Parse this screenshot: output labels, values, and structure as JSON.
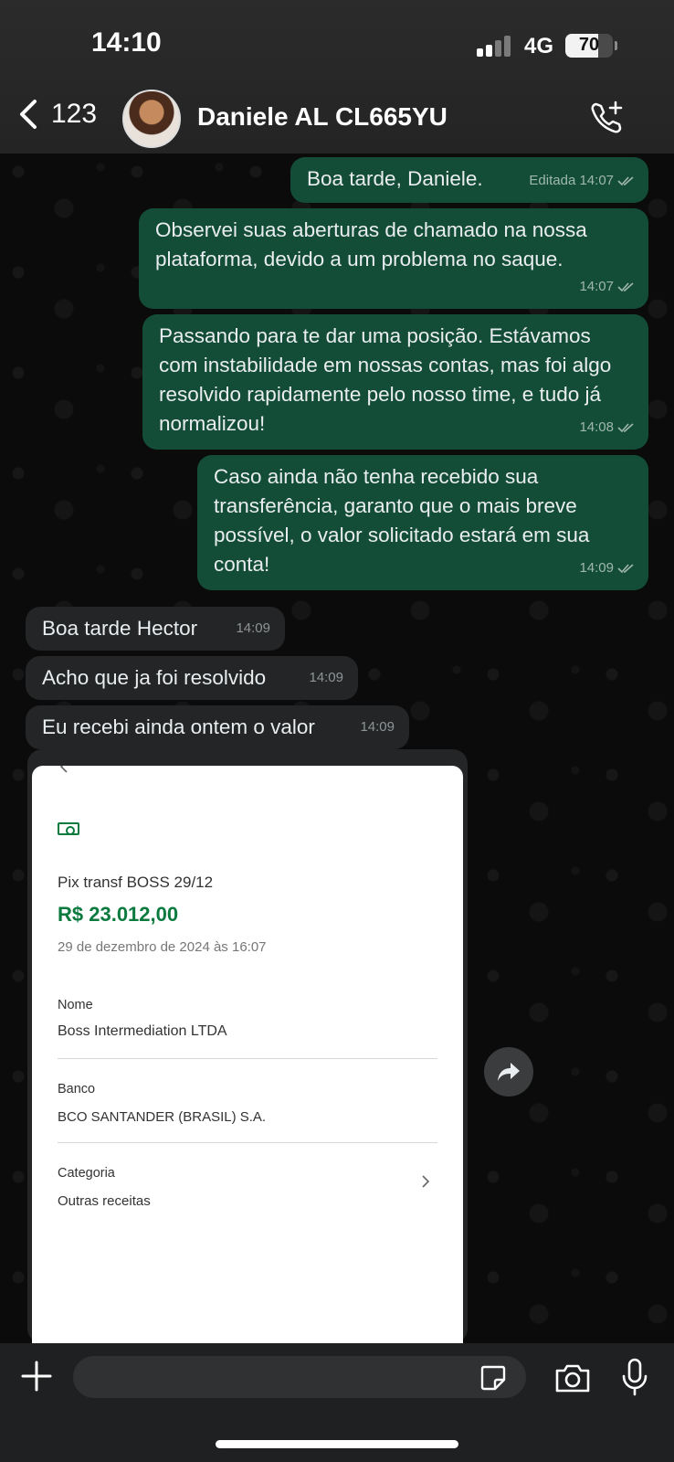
{
  "status_bar": {
    "time": "14:10",
    "network": "4G",
    "battery": "70"
  },
  "header": {
    "back_count": "123",
    "contact_name": "Daniele AL CL665YU"
  },
  "messages": [
    {
      "text": "Boa tarde, Daniele.",
      "meta": "Editada 14:07",
      "direction": "out"
    },
    {
      "text": "Observei suas aberturas de chamado na nossa plataforma, devido a um problema no saque.",
      "meta": "14:07",
      "direction": "out"
    },
    {
      "text": "Passando para te dar uma posição. Estávamos com instabilidade em nossas contas, mas foi algo resolvido rapidamente pelo nosso time, e tudo já normalizou!",
      "meta": "14:08",
      "direction": "out"
    },
    {
      "text": "Caso ainda não tenha recebido sua transferência, garanto que o mais breve possível, o valor solicitado estará em sua conta!",
      "meta": "14:09",
      "direction": "out"
    },
    {
      "text": "Boa tarde Hector",
      "meta": "14:09",
      "direction": "in"
    },
    {
      "text": "Acho que ja foi resolvido",
      "meta": "14:09",
      "direction": "in"
    },
    {
      "text": "Eu recebi ainda ontem o valor",
      "meta": "14:09",
      "direction": "in"
    }
  ],
  "receipt": {
    "title": "Pix transf BOSS 29/12",
    "amount": "R$ 23.012,00",
    "date": "29 de dezembro de 2024 às 16:07",
    "name_label": "Nome",
    "name_value": "Boss Intermediation LTDA",
    "bank_label": "Banco",
    "bank_value": "BCO SANTANDER (BRASIL) S.A.",
    "category_label": "Categoria",
    "category_value": "Outras receitas"
  },
  "icons": {
    "back": "chevron-left-icon",
    "call": "phone-plus-icon",
    "share": "forward-icon",
    "attach": "plus-icon",
    "sticker": "sticker-icon",
    "camera": "camera-icon",
    "mic": "microphone-icon"
  },
  "colors": {
    "outgoing_bubble": "#144d37",
    "incoming_bubble": "#232526",
    "amount_green": "#0a7a3e"
  }
}
